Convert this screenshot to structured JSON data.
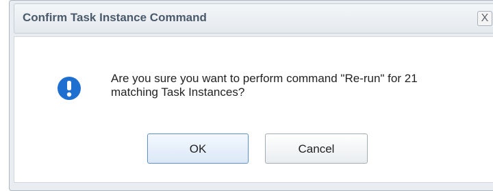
{
  "dialog": {
    "title": "Confirm Task Instance Command",
    "close_label": "X",
    "message": "Are you sure you want to perform command \"Re-run\" for 21 matching Task Instances?",
    "icon": "info-icon",
    "buttons": {
      "ok_label": "OK",
      "cancel_label": "Cancel"
    }
  },
  "colors": {
    "icon_blue": "#1f6fd0",
    "title_text": "#4a5a6b",
    "ok_border": "#5b8fcf"
  }
}
